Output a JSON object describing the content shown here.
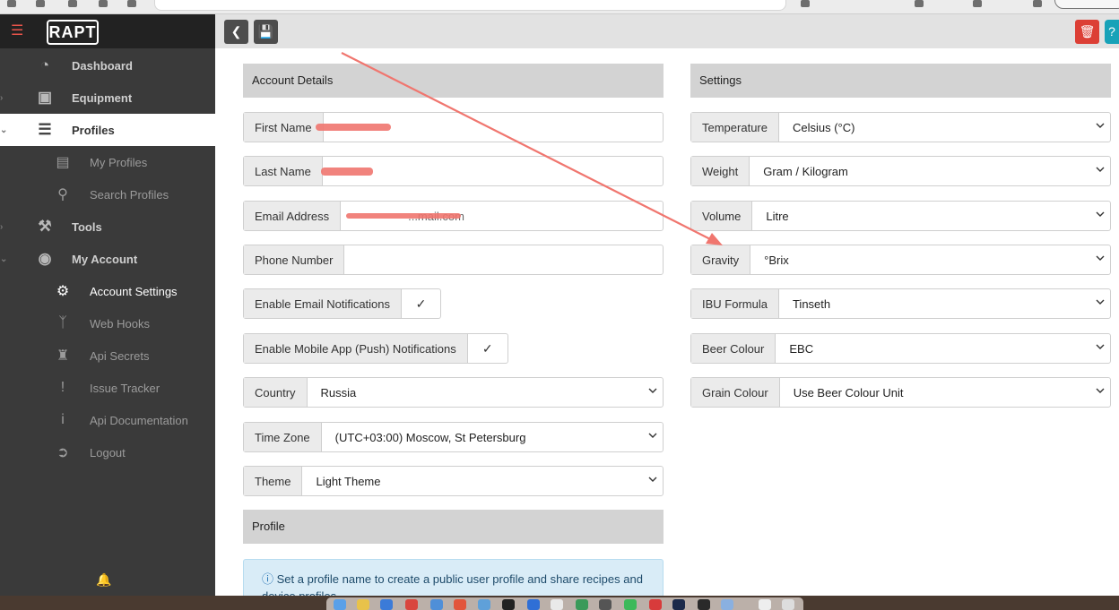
{
  "brand": {
    "logo_text": "RAPT"
  },
  "sidebar": {
    "items": [
      {
        "label": "Dashboard",
        "icon": "dashboard-icon"
      },
      {
        "label": "Equipment",
        "icon": "toolbox-icon"
      },
      {
        "label": "Profiles",
        "icon": "list-icon"
      },
      {
        "label": "My Profiles",
        "icon": "clipboard-icon"
      },
      {
        "label": "Search Profiles",
        "icon": "search-icon"
      },
      {
        "label": "Tools",
        "icon": "hammer-icon"
      },
      {
        "label": "My Account",
        "icon": "avatar-icon"
      },
      {
        "label": "Account Settings",
        "icon": "gears-icon"
      },
      {
        "label": "Web Hooks",
        "icon": "branch-icon"
      },
      {
        "label": "Api Secrets",
        "icon": "secret-agent-icon"
      },
      {
        "label": "Issue Tracker",
        "icon": "exclamation-icon"
      },
      {
        "label": "Api Documentation",
        "icon": "info-icon"
      },
      {
        "label": "Logout",
        "icon": "logout-icon"
      }
    ]
  },
  "account": {
    "heading": "Account Details",
    "first_name_label": "First Name",
    "last_name_label": "Last Name",
    "email_label": "Email Address",
    "email_visible": "...mail.com",
    "phone_label": "Phone Number",
    "email_notif_label": "Enable Email Notifications",
    "push_notif_label": "Enable Mobile App (Push) Notifications",
    "country_label": "Country",
    "country_value": "Russia",
    "timezone_label": "Time Zone",
    "timezone_value": "(UTC+03:00) Moscow, St Petersburg",
    "theme_label": "Theme",
    "theme_value": "Light Theme"
  },
  "profile": {
    "heading": "Profile",
    "info_text": "Set a profile name to create a public user profile and share recipes and device profiles"
  },
  "settings": {
    "heading": "Settings",
    "temperature_label": "Temperature",
    "temperature_value": "Celsius (°C)",
    "weight_label": "Weight",
    "weight_value": "Gram / Kilogram",
    "volume_label": "Volume",
    "volume_value": "Litre",
    "gravity_label": "Gravity",
    "gravity_value": "°Brix",
    "ibu_label": "IBU Formula",
    "ibu_value": "Tinseth",
    "beer_colour_label": "Beer Colour",
    "beer_colour_value": "EBC",
    "grain_colour_label": "Grain Colour",
    "grain_colour_value": "Use Beer Colour Unit"
  },
  "colors": {
    "accent_red": "#dc3f35",
    "annotation": "#f0766f",
    "sidebar_bg": "#3a3a3a"
  }
}
